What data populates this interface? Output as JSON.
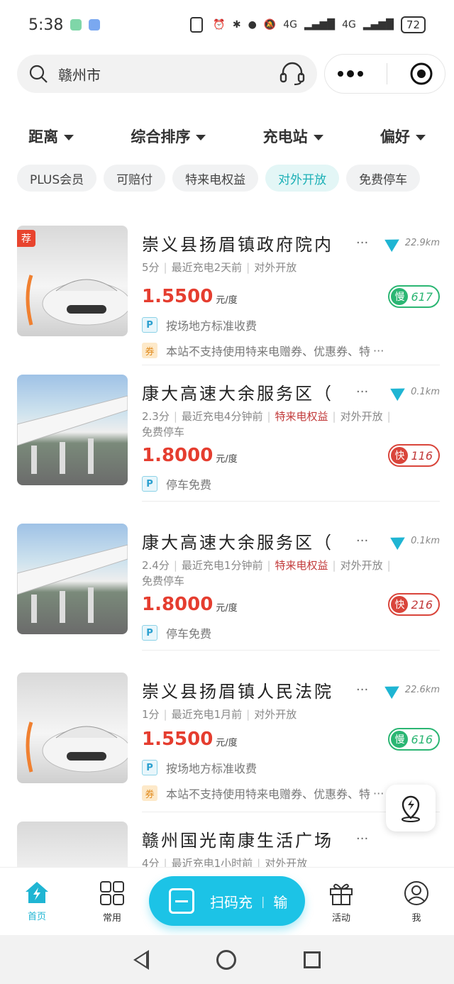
{
  "status_bar": {
    "time": "5:38",
    "network": "4G",
    "network2": "4G",
    "battery": "72"
  },
  "search": {
    "city": "赣州市"
  },
  "filters": [
    "距离",
    "综合排序",
    "充电站",
    "偏好"
  ],
  "chips": [
    {
      "label": "PLUS会员",
      "active": false
    },
    {
      "label": "可赔付",
      "active": false
    },
    {
      "label": "特来电权益",
      "active": false
    },
    {
      "label": "对外开放",
      "active": true
    },
    {
      "label": "免费停车",
      "active": false
    }
  ],
  "stations": [
    {
      "title": "崇义县扬眉镇政府院内",
      "distance": "22.9km",
      "score": "5分",
      "recent": "最近充电2天前",
      "tags": [
        "对外开放"
      ],
      "extra": "",
      "price": "1.5500",
      "unit": "元/度",
      "pill_type": "慢",
      "pill_count": "617",
      "parking": "按场地方标准收费",
      "coupon": "本站不支持使用特来电赠券、优惠券、特",
      "recommended": "荐",
      "image": "car"
    },
    {
      "title": "康大高速大余服务区（",
      "distance": "0.1km",
      "score": "2.3分",
      "recent": "最近充电4分钟前",
      "tags": [
        "特来电权益",
        "对外开放"
      ],
      "extra": "免费停车",
      "price": "1.8000",
      "unit": "元/度",
      "pill_type": "快",
      "pill_count": "116",
      "parking": "停车免费",
      "coupon": "",
      "recommended": "",
      "image": "station"
    },
    {
      "title": "康大高速大余服务区（",
      "distance": "0.1km",
      "score": "2.4分",
      "recent": "最近充电1分钟前",
      "tags": [
        "特来电权益",
        "对外开放"
      ],
      "extra": "免费停车",
      "price": "1.8000",
      "unit": "元/度",
      "pill_type": "快",
      "pill_count": "216",
      "parking": "停车免费",
      "coupon": "",
      "recommended": "",
      "image": "station"
    },
    {
      "title": "崇义县扬眉镇人民法院",
      "distance": "22.6km",
      "score": "1分",
      "recent": "最近充电1月前",
      "tags": [
        "对外开放"
      ],
      "extra": "",
      "price": "1.5500",
      "unit": "元/度",
      "pill_type": "慢",
      "pill_count": "616",
      "parking": "按场地方标准收费",
      "coupon": "本站不支持使用特来电赠券、优惠券、特",
      "recommended": "",
      "image": "car"
    },
    {
      "title": "赣州国光南康生活广场",
      "distance": "",
      "score": "4分",
      "recent": "最近充电1小时前",
      "tags": [
        "对外开放"
      ],
      "extra": "",
      "price": "",
      "unit": "",
      "pill_type": "",
      "pill_count": "",
      "parking": "",
      "coupon": "",
      "recommended": "",
      "image": "car"
    }
  ],
  "tabbar": {
    "home": "首页",
    "common": "常用",
    "scan": "扫码充",
    "scan_next": "输",
    "activity": "活动",
    "me": "我"
  },
  "colors": {
    "accent": "#1cc3e6",
    "price": "#e53d2f",
    "slow": "#2bb673",
    "fast": "#d9453b"
  }
}
